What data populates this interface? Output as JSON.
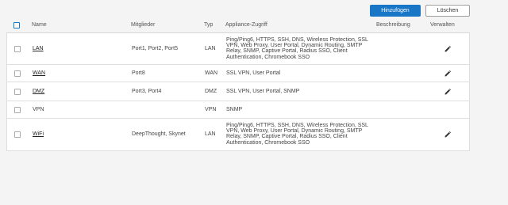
{
  "toolbar": {
    "add_label": "Hinzufügen",
    "delete_label": "Löschen"
  },
  "columns": {
    "name": "Name",
    "members": "Mitglieder",
    "type": "Typ",
    "access": "Appliance-Zugriff",
    "description": "Beschreibung",
    "manage": "Verwalten"
  },
  "rows": [
    {
      "name": "LAN",
      "linked": true,
      "members": "Port1, Port2, Port5",
      "type": "LAN",
      "access": "Ping/Ping6, HTTPS, SSH, DNS, Wireless Protection, SSL VPN, Web Proxy, User Portal, Dynamic Routing, SMTP Relay, SNMP, Captive Portal, Radius SSO, Client Authentication, Chromebook SSO",
      "description": "",
      "editable": true
    },
    {
      "name": "WAN",
      "linked": true,
      "members": "Port8",
      "type": "WAN",
      "access": "SSL VPN, User Portal",
      "description": "",
      "editable": true
    },
    {
      "name": "DMZ",
      "linked": true,
      "members": "Port3, Port4",
      "type": "DMZ",
      "access": "SSL VPN, User Portal, SNMP",
      "description": "",
      "editable": true
    },
    {
      "name": "VPN",
      "linked": false,
      "members": "",
      "type": "VPN",
      "access": "SNMP",
      "description": "",
      "editable": false
    },
    {
      "name": "WiFi",
      "linked": true,
      "members": "DeepThought, Skynet",
      "type": "LAN",
      "access": "Ping/Ping6, HTTPS, SSH, DNS, Wireless Protection, SSL VPN, Web Proxy, User Portal, Dynamic Routing, SMTP Relay, SNMP, Captive Portal, Radius SSO, Client Authentication, Chromebook SSO",
      "description": "",
      "editable": true
    }
  ],
  "icons": {
    "edit": "pencil-icon",
    "select_all": "checkbox-icon"
  },
  "colors": {
    "primary": "#1976c7",
    "row_bg": "#ffffff",
    "page_bg": "#f4f4f4"
  }
}
